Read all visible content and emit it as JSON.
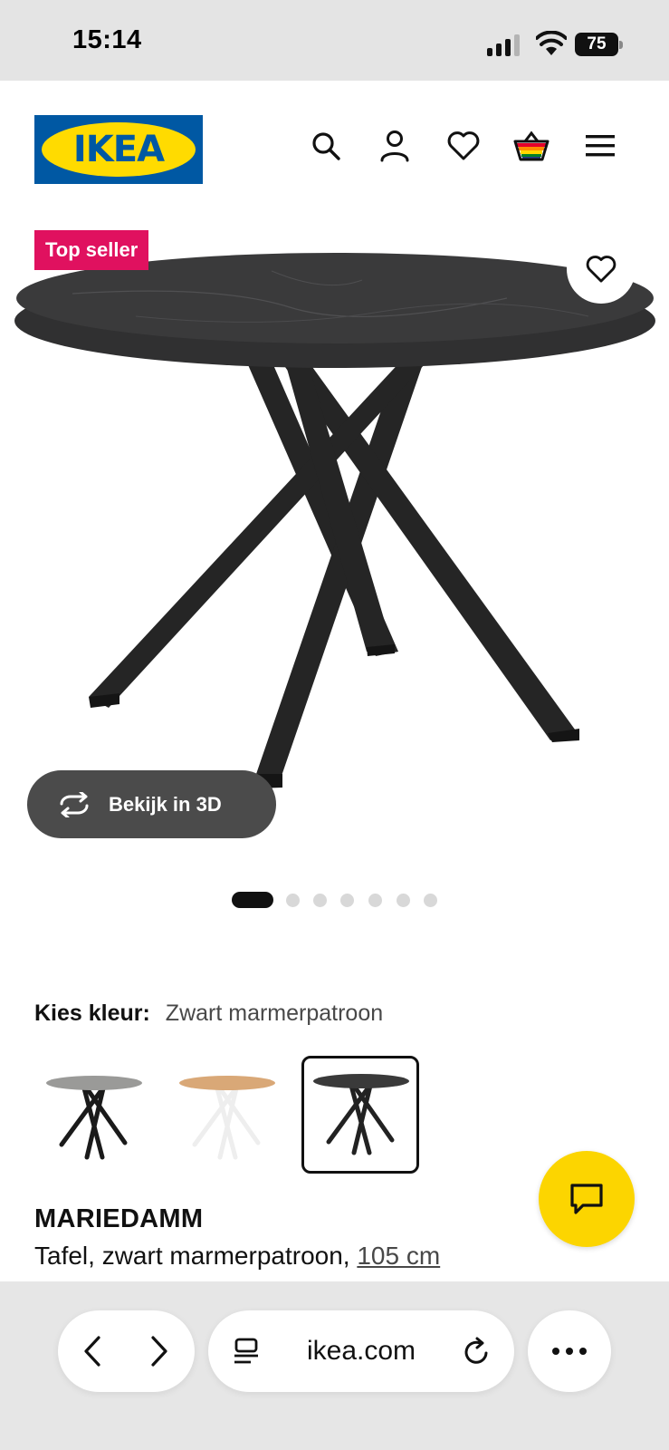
{
  "status_bar": {
    "time": "15:14",
    "battery": "75"
  },
  "header": {
    "logo_text": "IKEA",
    "icons": [
      "search-icon",
      "account-icon",
      "heart-icon",
      "cart-icon",
      "menu-icon"
    ]
  },
  "gallery": {
    "badge": "Top seller",
    "view_3d_label": "Bekijk in 3D",
    "image_count": 7,
    "active_image": 1
  },
  "colour": {
    "label": "Kies kleur:",
    "selected_value": "Zwart marmerpatroon",
    "swatches": [
      {
        "name": "grey",
        "top_color": "#9a9a98",
        "leg_color": "#1a1a1a"
      },
      {
        "name": "oak-white",
        "top_color": "#d9a877",
        "leg_color": "#f4f4f4"
      },
      {
        "name": "black-marble",
        "top_color": "#3a3a3a",
        "leg_color": "#222222",
        "selected": true
      }
    ]
  },
  "product": {
    "name": "MARIEDAMM",
    "description": "Tafel, zwart marmerpatroon,",
    "size": "105 cm"
  },
  "browser": {
    "url": "ikea.com"
  },
  "colors": {
    "badge_pink": "#e0115f",
    "chat_yellow": "#fcd500",
    "ikea_blue": "#0058a3",
    "ikea_yellow": "#ffdb00"
  }
}
